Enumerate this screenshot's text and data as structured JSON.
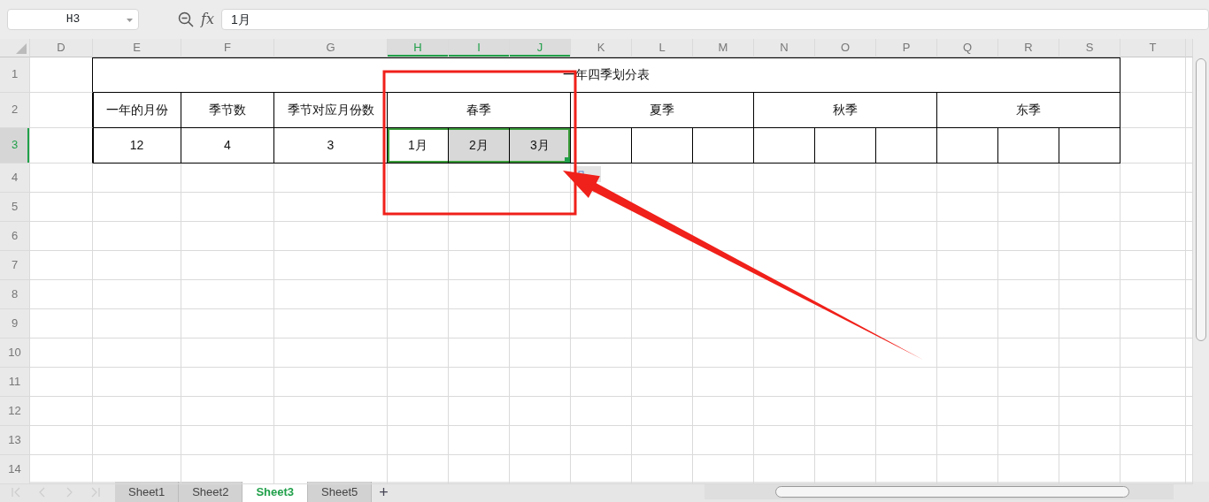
{
  "name_box": {
    "value": "H3"
  },
  "formula_bar": {
    "label": "fx",
    "value": "1月"
  },
  "columns": [
    {
      "label": "D",
      "selected": false
    },
    {
      "label": "E",
      "selected": false
    },
    {
      "label": "F",
      "selected": false
    },
    {
      "label": "G",
      "selected": false
    },
    {
      "label": "H",
      "selected": true
    },
    {
      "label": "I",
      "selected": true
    },
    {
      "label": "J",
      "selected": true
    },
    {
      "label": "K",
      "selected": false
    },
    {
      "label": "L",
      "selected": false
    },
    {
      "label": "M",
      "selected": false
    },
    {
      "label": "N",
      "selected": false
    },
    {
      "label": "O",
      "selected": false
    },
    {
      "label": "P",
      "selected": false
    },
    {
      "label": "Q",
      "selected": false
    },
    {
      "label": "R",
      "selected": false
    },
    {
      "label": "S",
      "selected": false
    },
    {
      "label": "T",
      "selected": false
    }
  ],
  "rows": [
    {
      "label": "1",
      "selected": false
    },
    {
      "label": "2",
      "selected": false
    },
    {
      "label": "3",
      "selected": true
    },
    {
      "label": "4",
      "selected": false
    },
    {
      "label": "5",
      "selected": false
    },
    {
      "label": "6",
      "selected": false
    },
    {
      "label": "7",
      "selected": false
    },
    {
      "label": "8",
      "selected": false
    },
    {
      "label": "9",
      "selected": false
    },
    {
      "label": "10",
      "selected": false
    },
    {
      "label": "11",
      "selected": false
    },
    {
      "label": "12",
      "selected": false
    },
    {
      "label": "13",
      "selected": false
    },
    {
      "label": "14",
      "selected": false
    }
  ],
  "table": {
    "title": "一年四季划分表",
    "headers": [
      "一年的月份",
      "季节数",
      "季节对应月份数"
    ],
    "seasons": [
      "春季",
      "夏季",
      "秋季",
      "东季"
    ],
    "values": [
      "12",
      "4",
      "3"
    ],
    "months": [
      {
        "text": "1月",
        "selected": true,
        "active": true
      },
      {
        "text": "2月",
        "selected": true,
        "active": false
      },
      {
        "text": "3月",
        "selected": true,
        "active": false
      }
    ]
  },
  "annotations": [
    {
      "kind": "rectangle"
    },
    {
      "kind": "arrow"
    }
  ],
  "sheet_tabs": [
    {
      "label": "Sheet1",
      "selected": false
    },
    {
      "label": "Sheet2",
      "selected": false
    },
    {
      "label": "Sheet3",
      "selected": true
    },
    {
      "label": "Sheet5",
      "selected": false
    }
  ],
  "add_sheet": "+"
}
